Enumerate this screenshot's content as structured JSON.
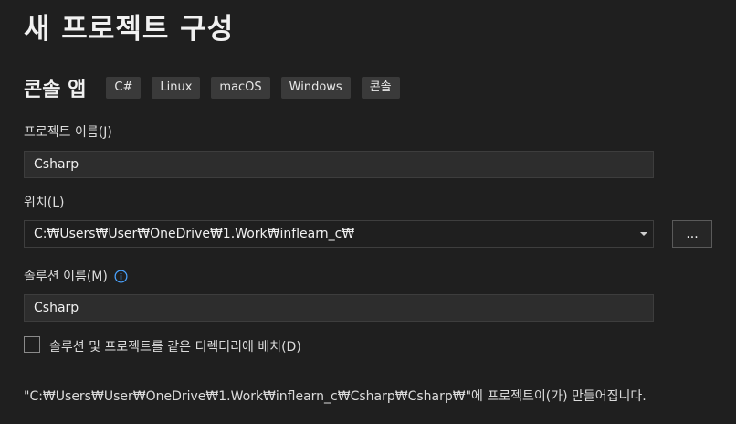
{
  "header": {
    "title": "새 프로젝트 구성"
  },
  "template": {
    "name": "콘솔 앱",
    "tags": [
      "C#",
      "Linux",
      "macOS",
      "Windows",
      "콘솔"
    ]
  },
  "project_name": {
    "label": "프로젝트 이름(J)",
    "value": "Csharp"
  },
  "location": {
    "label": "위치(L)",
    "value": "C:₩Users₩User₩OneDrive₩1.Work₩inflearn_c₩",
    "browse_label": "..."
  },
  "solution_name": {
    "label": "솔루션 이름(M)",
    "value": "Csharp",
    "info_icon": "info-icon"
  },
  "same_directory": {
    "label": "솔루션 및 프로젝트를 같은 디렉터리에 배치(D)",
    "checked": false
  },
  "summary": {
    "text": "\"C:₩Users₩User₩OneDrive₩1.Work₩inflearn_c₩Csharp₩Csharp₩\"에 프로젝트이(가) 만들어집니다."
  },
  "colors": {
    "background": "#1f1f1f",
    "field_background": "#2d2d2d",
    "tag_background": "#3a3a3a",
    "info_accent": "#4aa3ff"
  }
}
